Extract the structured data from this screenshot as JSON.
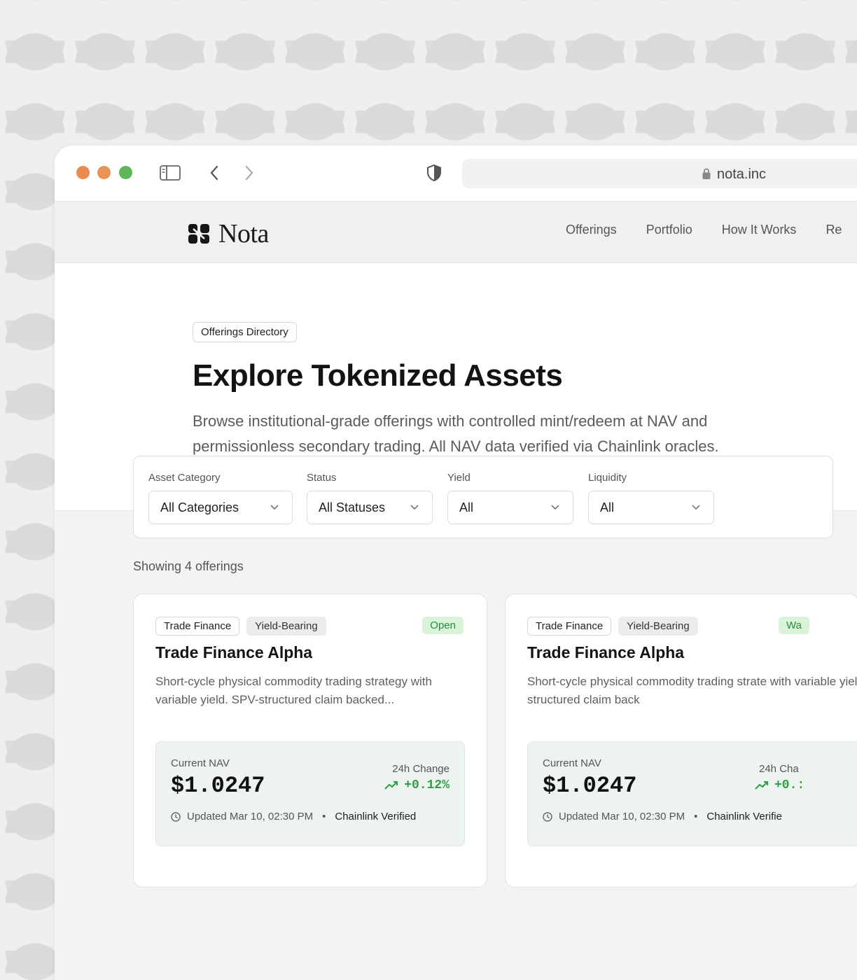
{
  "browser": {
    "url": "nota.inc"
  },
  "header": {
    "logo_text": "Nota",
    "nav": [
      "Offerings",
      "Portfolio",
      "How It Works",
      "Re"
    ]
  },
  "hero": {
    "badge": "Offerings Directory",
    "title": "Explore Tokenized Assets",
    "description": "Browse institutional-grade offerings with controlled mint/redeem at NAV and permissionless secondary trading. All NAV data verified via Chainlink oracles."
  },
  "filters": [
    {
      "label": "Asset Category",
      "value": "All Categories"
    },
    {
      "label": "Status",
      "value": "All Statuses"
    },
    {
      "label": "Yield",
      "value": "All"
    },
    {
      "label": "Liquidity",
      "value": "All"
    }
  ],
  "results": {
    "showing": "Showing 4 offerings"
  },
  "cards": [
    {
      "tags": [
        "Trade Finance",
        "Yield-Bearing"
      ],
      "status": "Open",
      "title": "Trade Finance Alpha",
      "description": "Short-cycle physical commodity trading strategy with variable yield. SPV-structured claim backed...",
      "nav_label": "Current NAV",
      "nav_value": "$1.0247",
      "change_label": "24h Change",
      "change_value": "+0.12%",
      "updated": "Updated Mar 10, 02:30 PM",
      "verified": "Chainlink Verified"
    },
    {
      "tags": [
        "Trade Finance",
        "Yield-Bearing"
      ],
      "status": "Wa",
      "title": "Trade Finance Alpha",
      "description": "Short-cycle physical commodity trading strate with variable yield. SPV-structured claim back",
      "nav_label": "Current NAV",
      "nav_value": "$1.0247",
      "change_label": "24h Cha",
      "change_value": "+0.:",
      "updated": "Updated Mar 10, 02:30 PM",
      "verified": "Chainlink Verifie"
    }
  ],
  "colors": {
    "accent_green": "#2f9e44",
    "status_bg": "#d8f3d8",
    "nav_box_bg": "#edf3ef"
  }
}
